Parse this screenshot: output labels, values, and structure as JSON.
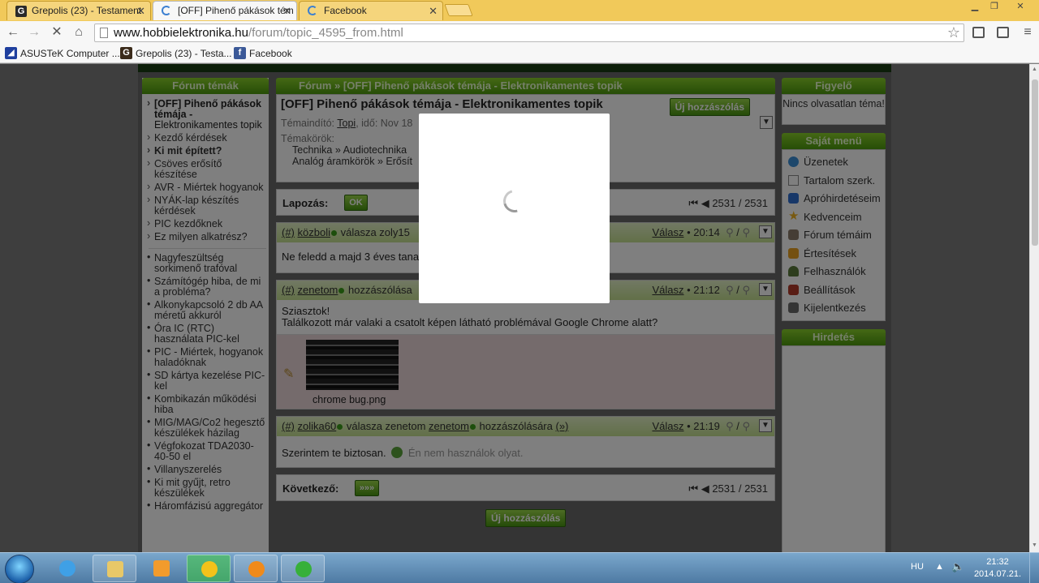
{
  "browser": {
    "tabs": [
      {
        "title": "Grepolis (23) - Testament",
        "favicon": "G",
        "color": "#2a2a2a"
      },
      {
        "title": "[OFF] Pihenő pákások tém",
        "favicon": "",
        "color": "#3b7fd1"
      },
      {
        "title": "Facebook",
        "favicon": "",
        "color": "#3b7fd1"
      }
    ],
    "url_host": "www.hobbielektronika.hu",
    "url_path": "/forum/topic_4595_from.html",
    "bookmarks": [
      {
        "label": "ASUSTeK Computer ...",
        "favicon": "asus-icon",
        "color": "#1f3f9e"
      },
      {
        "label": "Grepolis (23) - Testa...",
        "favicon": "G",
        "color": "#3a2a1a"
      },
      {
        "label": "Facebook",
        "favicon": "f",
        "color": "#3b5998"
      }
    ]
  },
  "left": {
    "header": "Fórum témák",
    "current_topic_bold": "[OFF] Pihenő pákások témája -",
    "current_topic_rest": "Elektronikamentes topik",
    "links": [
      "Kezdő kérdések",
      "Ki mit épített?",
      "Csöves erősítő készítése",
      "AVR - Miértek hogyanok",
      "NYÁK-lap készítés kérdések",
      "PIC kezdőknek",
      "Ez milyen alkatrész?"
    ],
    "hot": [
      "Nagyfeszültség sorkimenő trafóval",
      "Számítógép hiba, de mi a probléma?",
      "Alkonykapcsoló 2 db AA méretű akkuról",
      "Óra IC (RTC) használata PIC-kel",
      "PIC - Miértek, hogyanok haladóknak",
      "SD kártya kezelése PIC-kel",
      "Kombikazán működési hiba",
      "MIG/MAG/Co2 hegesztő készülékek házilag",
      "Végfokozat TDA2030-40-50 el",
      "Villanyszerelés",
      "Ki mit gyűjt, retro készülékek",
      "Háromfázisú aggregátor"
    ]
  },
  "main": {
    "breadcrumb_header": "Fórum » [OFF] Pihenő pákások témája - Elektronikamentes topik",
    "title": "[OFF] Pihenő pákások témája - Elektronikamentes topik",
    "new_post": "Új hozzászólás",
    "starter_label": "Témaindító:",
    "starter_name": "Topi",
    "starter_time": ", idő: Nov 18",
    "categories_label": "Témakörök:",
    "cat1a": "Technika",
    "cat1b": "Audiotechnika",
    "cat2a": "Analóg áramkörök",
    "cat2b": "Erősít",
    "crumb_sep": "»",
    "pager_label": "Lapozás:",
    "ok": "OK",
    "page_info": "2531 / 2531",
    "reply": "Válasz",
    "posts": [
      {
        "hash": "(#)",
        "user": "közboli",
        "action": "válasza zoly15",
        "time": "• 20:14",
        "body": "Ne feledd a majd 3 éves tana"
      },
      {
        "hash": "(#)",
        "user": "zenetom",
        "action": "hozzászólása",
        "time": "• 21:12",
        "body1": "Sziasztok!",
        "body2": "Találkozott már valaki a csatolt képen látható problémával Google Chrome alatt?",
        "attachment": "chrome bug.png"
      },
      {
        "hash": "(#)",
        "user": "zolika60",
        "action": "válasza zenetom",
        "action2": "hozzászólására",
        "link": "(»)",
        "time": "• 21:19",
        "body": "Szerintem te biztosan.",
        "quote": "Én nem használok olyat."
      }
    ],
    "next_label": "Következő:",
    "next_btn": "»»»",
    "slash": "/"
  },
  "right": {
    "watch_header": "Figyelő",
    "watch_text": "Nincs olvasatlan téma!",
    "menu_header": "Saját menü",
    "menu": [
      {
        "label": "Üzenetek",
        "icon": "chat-bubble-icon",
        "color": "#3b8fd6"
      },
      {
        "label": "Tartalom szerk.",
        "icon": "document-icon",
        "color": "#8a8a8a"
      },
      {
        "label": "Apróhirdetéseim",
        "icon": "arrow-icon",
        "color": "#2f6fd0"
      },
      {
        "label": "Kedvenceim",
        "icon": "star-icon",
        "color": "#f0b321"
      },
      {
        "label": "Fórum témáim",
        "icon": "book-icon",
        "color": "#8a7a6a"
      },
      {
        "label": "Értesítések",
        "icon": "tag-icon",
        "color": "#e9a020"
      },
      {
        "label": "Felhasználók",
        "icon": "user-icon",
        "color": "#5a7a3a"
      },
      {
        "label": "Beállítások",
        "icon": "tools-icon",
        "color": "#b33a2a"
      },
      {
        "label": "Kijelentkezés",
        "icon": "logout-icon",
        "color": "#6a6a6a"
      }
    ],
    "ads_header": "Hirdetés"
  },
  "taskbar": {
    "lang": "HU",
    "time": "21:32",
    "date": "2014.07.21."
  }
}
